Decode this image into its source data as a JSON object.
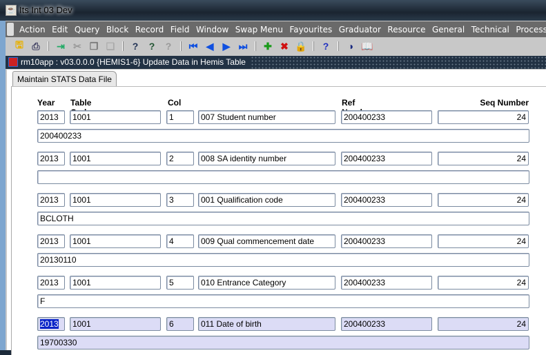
{
  "window": {
    "title": "Its Int 03 Dev"
  },
  "menu": [
    "Action",
    "Edit",
    "Query",
    "Block",
    "Record",
    "Field",
    "Window",
    "Swap Menu",
    "Fayourites",
    "Graduator",
    "Resource",
    "General",
    "Technical",
    "Processes"
  ],
  "toolbar": [
    "save-icon",
    "print-icon",
    "exit-icon",
    "cut-icon",
    "copy-icon",
    "paste-icon",
    "enter-query-icon",
    "execute-query-icon",
    "cancel-query-icon",
    "first-record-icon",
    "previous-record-icon",
    "next-record-icon",
    "last-record-icon",
    "insert-record-icon",
    "delete-record-icon",
    "lock-record-icon",
    "help-icon",
    "oracle-icon",
    "book-icon"
  ],
  "form": {
    "title": "rm10app : v03.0.0.0  {HEMIS1-6} Update Data in Hemis Table",
    "tab": "Maintain STATS Data File"
  },
  "headers": {
    "year": "Year",
    "table_code": "Table Code",
    "col": "Col",
    "ref": "Ref Number",
    "seq": "Seq Number"
  },
  "records": [
    {
      "year": "2013",
      "table_code": "1001",
      "col": "1",
      "desc": "007 Student number",
      "ref": "200400233",
      "seq": "24",
      "value": "200400233"
    },
    {
      "year": "2013",
      "table_code": "1001",
      "col": "2",
      "desc": "008 SA identity number",
      "ref": "200400233",
      "seq": "24",
      "value": ""
    },
    {
      "year": "2013",
      "table_code": "1001",
      "col": "3",
      "desc": "001 Qualification code",
      "ref": "200400233",
      "seq": "24",
      "value": "BCLOTH"
    },
    {
      "year": "2013",
      "table_code": "1001",
      "col": "4",
      "desc": "009 Qual commencement date",
      "ref": "200400233",
      "seq": "24",
      "value": "20130110"
    },
    {
      "year": "2013",
      "table_code": "1001",
      "col": "5",
      "desc": "010 Entrance Category",
      "ref": "200400233",
      "seq": "24",
      "value": "F"
    },
    {
      "year": "2013",
      "table_code": "1001",
      "col": "6",
      "desc": "011 Date of birth",
      "ref": "200400233",
      "seq": "24",
      "value": "19700330"
    }
  ]
}
